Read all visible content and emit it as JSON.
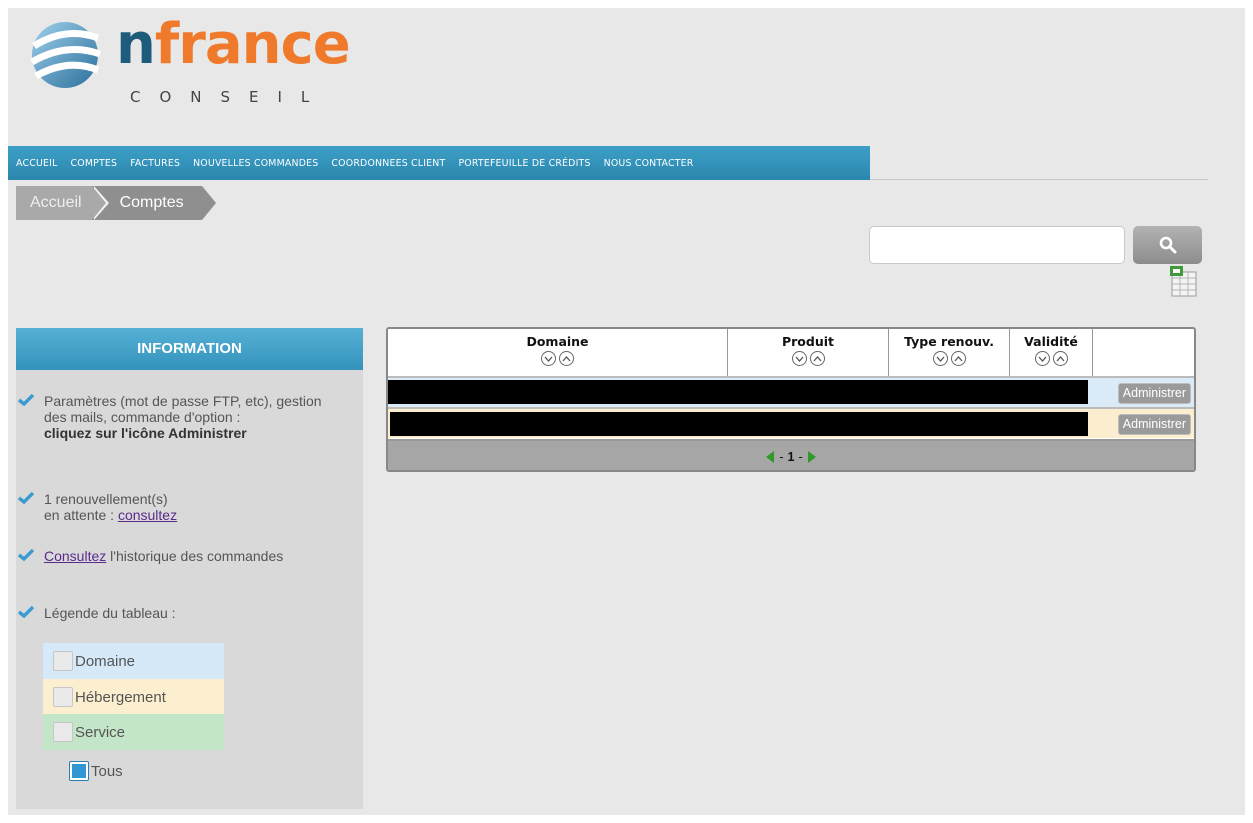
{
  "brand": {
    "name_first": "n",
    "name_rest": "france",
    "subtitle": "CONSEIL"
  },
  "nav": {
    "items": [
      "ACCUEIL",
      "COMPTES",
      "FACTURES",
      "NOUVELLES COMMANDES",
      "COORDONNEES CLIENT",
      "PORTEFEUILLE DE CRÉDITS",
      "NOUS CONTACTER"
    ]
  },
  "breadcrumb": {
    "home": "Accueil",
    "current": "Comptes"
  },
  "search": {
    "value": "",
    "placeholder": ""
  },
  "info": {
    "title": "INFORMATION",
    "item1_text": "Paramètres (mot de passe FTP, etc), gestion des mails, commande d'option :",
    "item1_bold": "cliquez sur l'icône Administrer",
    "item2_line1": "1 renouvellement(s)",
    "item2_prefix": "en attente : ",
    "item2_link": "consultez",
    "item3_link": "Consultez",
    "item3_text": " l'historique des commandes",
    "item4_text": "Légende du tableau :",
    "legend": [
      "Domaine",
      "Hébergement",
      "Service",
      "Tous"
    ]
  },
  "table": {
    "columns": [
      "Domaine",
      "Produit",
      "Type renouv.",
      "Validité"
    ],
    "rows": [
      {
        "action": "Administrer"
      },
      {
        "action": "Administrer"
      }
    ],
    "pager": {
      "left": "-",
      "current": "1",
      "right": "-"
    }
  },
  "colors": {
    "accent": "#3393bb",
    "brand_orange": "#f07a2b",
    "brand_blue": "#1f5c7c",
    "legend_domaine": "#d5e9f8",
    "legend_hebergement": "#fcefcf",
    "legend_service": "#c4e6c8"
  }
}
